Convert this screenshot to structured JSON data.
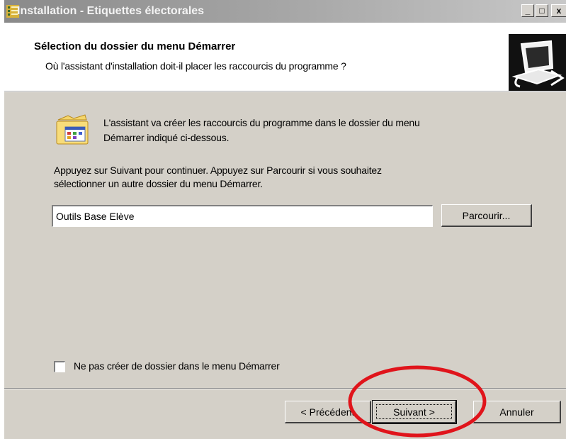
{
  "window": {
    "title": "Installation - Etiquettes électorales",
    "controls": {
      "minimize": "_",
      "maximize": "□",
      "close": "x"
    }
  },
  "header": {
    "title": "Sélection du dossier du menu Démarrer",
    "subtitle": "Où l'assistant d'installation doit-il placer les raccourcis du programme ?",
    "icon": "computer-icon"
  },
  "content": {
    "icon": "program-folder-icon",
    "intro_line1": "L'assistant va créer les raccourcis du programme dans le dossier du menu",
    "intro_line2": "Démarrer indiqué ci-dessous.",
    "instructions_line1": "Appuyez sur Suivant pour continuer. Appuyez sur Parcourir si vous souhaitez",
    "instructions_line2": "sélectionner un autre dossier du menu Démarrer.",
    "folder_value": "Outils Base Elève",
    "browse_label": "Parcourir...",
    "checkbox_label": "Ne pas créer de dossier dans le menu Démarrer",
    "checkbox_checked": false
  },
  "footer": {
    "back_label": "< Précédent",
    "next_label": "Suivant >",
    "cancel_label": "Annuler"
  },
  "annotation": {
    "shape": "ellipse",
    "color": "#e0141b",
    "target": "next-button"
  },
  "colors": {
    "dialog_bg": "#d4d0c8",
    "title_bar": "#a9a9a9",
    "header_bg": "#ffffff"
  }
}
